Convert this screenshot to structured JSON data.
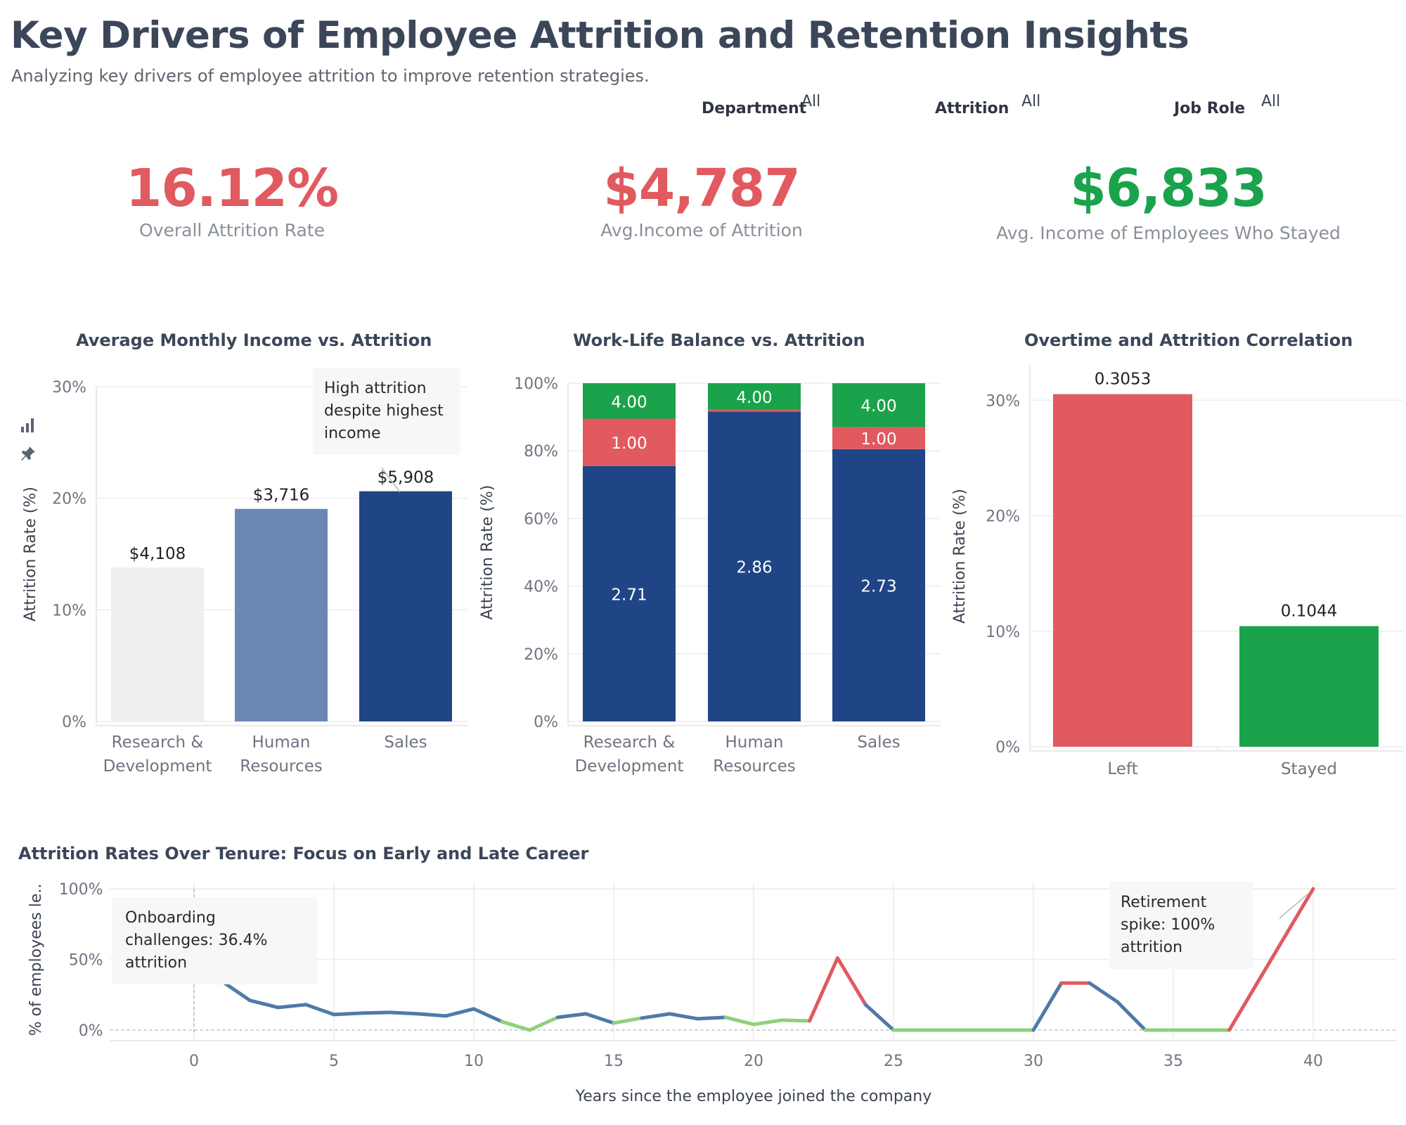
{
  "header": {
    "title": "Key Drivers of Employee Attrition and Retention Insights",
    "subtitle": "Analyzing key drivers of employee attrition to improve retention strategies."
  },
  "filters": [
    {
      "label": "Department",
      "value": "All"
    },
    {
      "label": "Attrition",
      "value": "All"
    },
    {
      "label": "Job Role",
      "value": "All"
    }
  ],
  "kpis": [
    {
      "value": "16.12%",
      "label": "Overall Attrition Rate",
      "color": "#e05a5f"
    },
    {
      "value": "$4,787",
      "label": "Avg.Income of Attrition",
      "color": "#e05a5f"
    },
    {
      "value": "$6,833",
      "label": "Avg. Income of Employees Who Stayed",
      "color": "#1aa34a"
    }
  ],
  "icons": {
    "bar": "bar-chart-icon",
    "pin": "pin-icon"
  },
  "chart_data": [
    {
      "type": "bar",
      "title": "Average Monthly Income vs. Attrition",
      "ylabel": "Attrition Rate (%)",
      "categories": [
        "Research & Development",
        "Human Resources",
        "Sales"
      ],
      "category_lines": [
        [
          "Research &",
          "Development"
        ],
        [
          "Human",
          "Resources"
        ],
        [
          "Sales"
        ]
      ],
      "values": [
        13.8,
        19.05,
        20.63
      ],
      "data_labels": [
        "$4,108",
        "$3,716",
        "$5,908"
      ],
      "colors": [
        "#efefef",
        "#6b88b5",
        "#1f4586"
      ],
      "ylim": [
        0,
        30
      ],
      "yticks": [
        "0%",
        "10%",
        "20%",
        "30%"
      ],
      "annotation": "High attrition despite highest income",
      "grid": true
    },
    {
      "type": "bar",
      "stacked": true,
      "title": "Work-Life Balance vs. Attrition",
      "ylabel": "Attrition Rate (%)",
      "categories": [
        "Research & Development",
        "Human Resources",
        "Sales"
      ],
      "category_lines": [
        [
          "Research &",
          "Development"
        ],
        [
          "Human",
          "Resources"
        ],
        [
          "Sales"
        ]
      ],
      "series": [
        {
          "values": [
            75.5,
            91.6,
            80.5
          ],
          "labels": [
            "2.71",
            "2.86",
            "2.73"
          ],
          "color": "#1f4586"
        },
        {
          "values": [
            14.0,
            0.6,
            6.6
          ],
          "labels": [
            "1.00",
            "",
            "1.00"
          ],
          "color": "#e05a5f"
        },
        {
          "values": [
            10.5,
            7.8,
            12.9
          ],
          "labels": [
            "4.00",
            "4.00",
            "4.00"
          ],
          "color": "#1aa34a"
        }
      ],
      "ylim": [
        0,
        100
      ],
      "yticks": [
        "0%",
        "20%",
        "40%",
        "60%",
        "80%",
        "100%"
      ],
      "grid": true
    },
    {
      "type": "bar",
      "title": "Overtime and Attrition Correlation",
      "ylabel": "Attrition Rate (%)",
      "categories": [
        "Left",
        "Stayed"
      ],
      "values": [
        30.53,
        10.44
      ],
      "data_labels": [
        "0.3053",
        "0.1044"
      ],
      "colors": [
        "#e05a5f",
        "#1aa34a"
      ],
      "ylim": [
        0,
        33
      ],
      "yticks": [
        "0%",
        "10%",
        "20%",
        "30%"
      ],
      "grid": true
    },
    {
      "type": "line",
      "title": "Attrition Rates Over Tenure: Focus on Early and Late Career",
      "xlabel": "Years since the employee joined the company",
      "ylabel": "% of employees le..",
      "x": [
        0,
        1,
        2,
        3,
        4,
        5,
        6,
        7,
        8,
        9,
        10,
        11,
        12,
        13,
        14,
        15,
        16,
        17,
        18,
        19,
        20,
        21,
        22,
        23,
        24,
        25,
        26,
        27,
        28,
        29,
        30,
        31,
        32,
        33,
        34,
        35,
        36,
        37,
        40
      ],
      "y": [
        36.4,
        34.5,
        21,
        16,
        18,
        11,
        12,
        12.5,
        11.5,
        10,
        15,
        6,
        0,
        9,
        11.5,
        5,
        8.5,
        11.5,
        8,
        9,
        4,
        7,
        6.5,
        51,
        18,
        0,
        0,
        0,
        0,
        0,
        0,
        33.3,
        33.3,
        20,
        0,
        0,
        0,
        0,
        100
      ],
      "xlim": [
        -3,
        43
      ],
      "ylim": [
        0,
        100
      ],
      "xticks": [
        "0",
        "5",
        "10",
        "15",
        "20",
        "25",
        "30",
        "35",
        "40"
      ],
      "yticks": [
        "0%",
        "50%",
        "100%"
      ],
      "annotations": [
        "Onboarding challenges: 36.4% attrition",
        "Retirement spike: 100% attrition"
      ],
      "grid": true
    }
  ]
}
